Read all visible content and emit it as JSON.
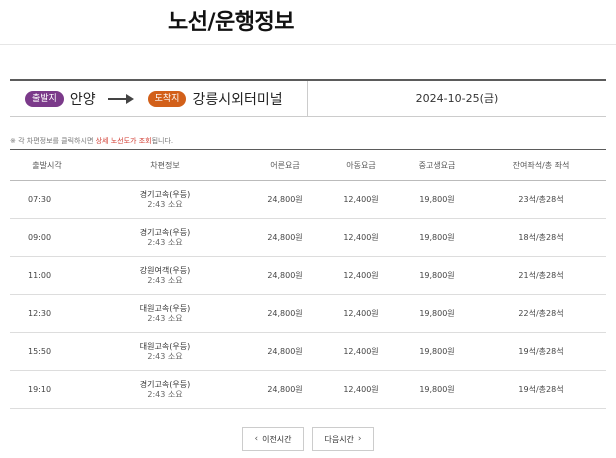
{
  "page": {
    "title": "노선/운행정보"
  },
  "route": {
    "departure_badge": "출발지",
    "departure": "안양",
    "arrival_badge": "도착지",
    "arrival": "강릉시외터미널",
    "date": "2024-10-25(금)"
  },
  "notice": {
    "prefix": "※ 각 차편정보를 클릭하시면 ",
    "highlight": "상세 노선도가 조회",
    "suffix": "됩니다."
  },
  "table": {
    "headers": [
      "출발시각",
      "차편정보",
      "어른요금",
      "아동요금",
      "중고생요금",
      "잔여좌석/총 좌석"
    ],
    "rows": [
      {
        "time": "07:30",
        "company": "경기고속(우등)",
        "duration": "2:43 소요",
        "adult": "24,800원",
        "child": "12,400원",
        "student": "19,800원",
        "seats": "23석/총28석"
      },
      {
        "time": "09:00",
        "company": "경기고속(우등)",
        "duration": "2:43 소요",
        "adult": "24,800원",
        "child": "12,400원",
        "student": "19,800원",
        "seats": "18석/총28석"
      },
      {
        "time": "11:00",
        "company": "강원여객(우등)",
        "duration": "2:43 소요",
        "adult": "24,800원",
        "child": "12,400원",
        "student": "19,800원",
        "seats": "21석/총28석"
      },
      {
        "time": "12:30",
        "company": "대원고속(우등)",
        "duration": "2:43 소요",
        "adult": "24,800원",
        "child": "12,400원",
        "student": "19,800원",
        "seats": "22석/총28석"
      },
      {
        "time": "15:50",
        "company": "대원고속(우등)",
        "duration": "2:43 소요",
        "adult": "24,800원",
        "child": "12,400원",
        "student": "19,800원",
        "seats": "19석/총28석"
      },
      {
        "time": "19:10",
        "company": "경기고속(우등)",
        "duration": "2:43 소요",
        "adult": "24,800원",
        "child": "12,400원",
        "student": "19,800원",
        "seats": "19석/총28석"
      }
    ]
  },
  "pager": {
    "prev_label": "이전시간",
    "next_label": "다음시간"
  },
  "colors": {
    "departure_badge": "#7b3a8a",
    "arrival_badge": "#d2601a",
    "highlight": "#d03a2f"
  },
  "icons": {
    "prev": "chevron-left-icon",
    "next": "chevron-right-icon",
    "route_arrow": "arrow-right-icon"
  }
}
